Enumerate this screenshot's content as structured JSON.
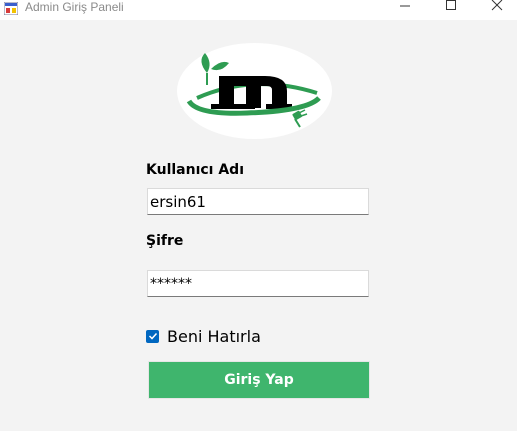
{
  "window": {
    "title": "Admin Giriş Paneli",
    "controls": [
      "minimize",
      "maximize",
      "close"
    ]
  },
  "logo": {
    "letter": "m",
    "colors": {
      "ring": "#2e9c52",
      "leaf": "#2e9c52",
      "letter": "#000000",
      "background": "#ffffff"
    }
  },
  "form": {
    "username_label": "Kullanıcı Adı",
    "username_value": "ersin61",
    "password_label": "Şifre",
    "password_value": "******",
    "remember_label": "Beni Hatırla",
    "remember_checked": true,
    "login_button": "Giriş Yap"
  },
  "colors": {
    "accent_green": "#3fb56d",
    "checkbox_blue": "#0067c0",
    "window_background": "#f3f3f3"
  }
}
